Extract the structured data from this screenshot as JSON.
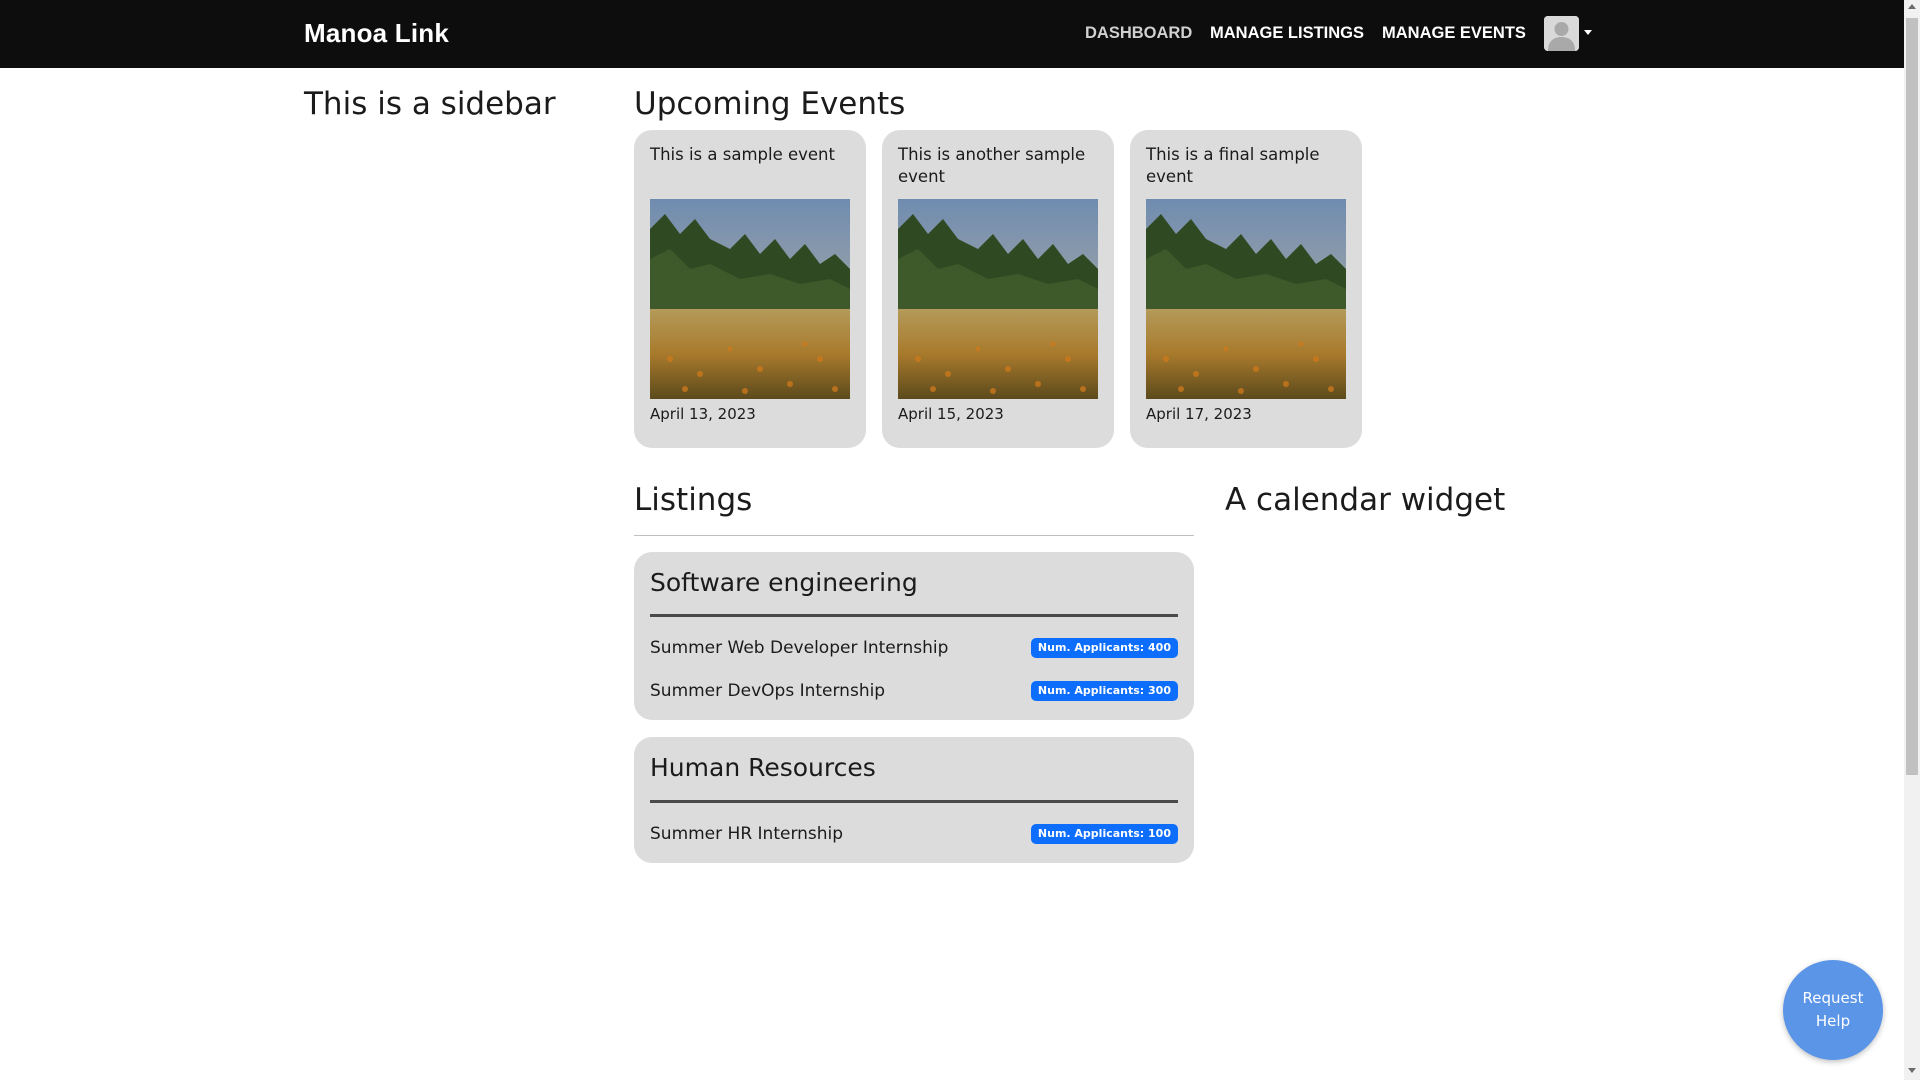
{
  "navbar": {
    "brand": "Manoa Link",
    "links": [
      {
        "label": "DASHBOARD"
      },
      {
        "label": "MANAGE LISTINGS"
      },
      {
        "label": "MANAGE EVENTS"
      }
    ],
    "avatar_icon": "user-avatar-icon"
  },
  "sidebar": {
    "heading": "This is a sidebar"
  },
  "events": {
    "heading": "Upcoming Events",
    "items": [
      {
        "title": "This is a sample event",
        "date": "April 13, 2023"
      },
      {
        "title": "This is another sample event",
        "date": "April 15, 2023"
      },
      {
        "title": "This is a final sample event",
        "date": "April 17, 2023"
      }
    ]
  },
  "listings": {
    "heading": "Listings",
    "groups": [
      {
        "title": "Software engineering",
        "items": [
          {
            "label": "Summer Web Developer Internship",
            "badge": "Num. Applicants: 400"
          },
          {
            "label": "Summer DevOps Internship",
            "badge": "Num. Applicants: 300"
          }
        ]
      },
      {
        "title": "Human Resources",
        "items": [
          {
            "label": "Summer HR Internship",
            "badge": "Num. Applicants: 100"
          }
        ]
      }
    ]
  },
  "calendar": {
    "heading": "A calendar widget"
  },
  "help": {
    "label": "Request Help"
  },
  "colors": {
    "navbar_bg": "#0d0d0d",
    "card_bg": "#dcdcdc",
    "badge_bg": "#0d6efd",
    "help_bg": "#5b95e8"
  }
}
